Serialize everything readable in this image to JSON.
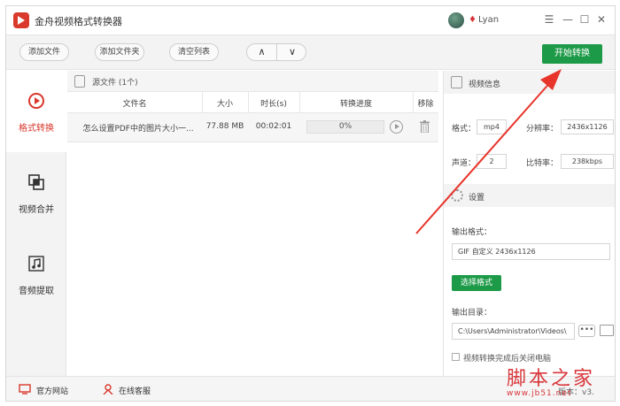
{
  "app": {
    "title": "金舟视频格式转换器",
    "user_name": "Lyan"
  },
  "window_controls": {
    "menu": "☰",
    "minimize": "—",
    "maximize": "☐",
    "close": "✕"
  },
  "toolbar": {
    "add_file": "添加文件",
    "add_folder": "添加文件夹",
    "clear_list": "清空列表",
    "move_up": "∧",
    "move_down": "∨",
    "start": "开始转换"
  },
  "sidebar": {
    "items": [
      {
        "label": "格式转换",
        "icon": "format-convert-icon",
        "active": true
      },
      {
        "label": "视频合并",
        "icon": "video-merge-icon",
        "active": false
      },
      {
        "label": "音频提取",
        "icon": "audio-extract-icon",
        "active": false
      }
    ]
  },
  "files": {
    "header": "源文件 (1个)",
    "columns": [
      "文件名",
      "大小",
      "时长(s)",
      "转换进度",
      "移除"
    ],
    "rows": [
      {
        "name": "怎么设置PDF中的图片大小一...",
        "size": "77.88 MB",
        "duration": "00:02:01",
        "progress": "0%"
      }
    ]
  },
  "video_info": {
    "title": "视频信息",
    "format_label": "格式：",
    "format_value": "mp4",
    "resolution_label": "分辨率：",
    "resolution_value": "2436x1126",
    "channel_label": "声道：",
    "channel_value": "2",
    "bitrate_label": "比特率：",
    "bitrate_value": "238kbps"
  },
  "settings": {
    "title": "设置",
    "output_format_label": "输出格式：",
    "output_format_value": "GIF 自定义 2436x1126",
    "choose_format": "选择格式",
    "output_dir_label": "输出目录：",
    "output_dir_value": "C:\\Users\\Administrator\\Videos\\",
    "browse": "•••",
    "shutdown_label": "视频转换完成后关闭电脑"
  },
  "statusbar": {
    "website": "官方网站",
    "support": "在线客服",
    "version": "版本：v3."
  },
  "watermark": {
    "main": "脚本之家",
    "sub": "www.jb51.net"
  },
  "colors": {
    "accent_green": "#1c9a47",
    "brand_red": "#d93a2b",
    "annotation_red": "#e8352c"
  }
}
